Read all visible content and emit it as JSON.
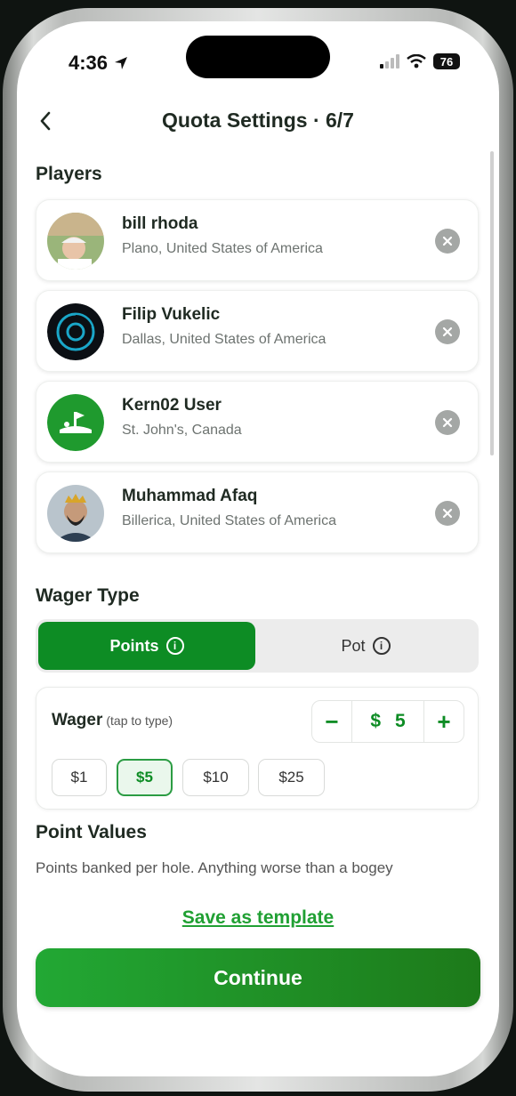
{
  "status_bar": {
    "time": "4:36",
    "battery": "76"
  },
  "header": {
    "title": "Quota Settings · 6/7"
  },
  "players_section": {
    "title": "Players"
  },
  "players": [
    {
      "name": "bill rhoda",
      "location": "Plano, United States of America",
      "avatar": "photo-golfer"
    },
    {
      "name": "Filip Vukelic",
      "location": "Dallas, United States of America",
      "avatar": "logo-spiral"
    },
    {
      "name": "Kern02 User",
      "location": "St. John's, Canada",
      "avatar": "logo-green-course"
    },
    {
      "name": "Muhammad Afaq",
      "location": "Billerica, United States of America",
      "avatar": "photo-person"
    }
  ],
  "wager_type": {
    "title": "Wager Type",
    "options": [
      {
        "label": "Points",
        "selected": true
      },
      {
        "label": "Pot",
        "selected": false
      }
    ]
  },
  "wager": {
    "label": "Wager",
    "hint": "(tap to type)",
    "currency": "$",
    "value": "5",
    "decrement": "−",
    "increment": "+",
    "presets": [
      "$1",
      "$5",
      "$10",
      "$25"
    ],
    "selected_preset": "$5"
  },
  "point_values": {
    "title": "Point Values",
    "description": "Points banked per hole. Anything worse than a bogey"
  },
  "actions": {
    "save_template": "Save as template",
    "continue": "Continue"
  },
  "colors": {
    "accent": "#0d8c24",
    "link": "#20a033"
  }
}
